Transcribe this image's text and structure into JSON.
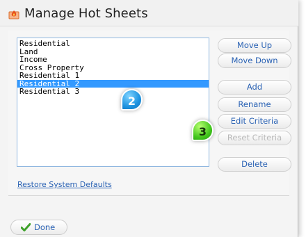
{
  "dialog": {
    "title": "Manage Hot Sheets",
    "title_icon": "flame-icon"
  },
  "hot_sheets": {
    "items": [
      "Residential",
      "Land",
      "Income",
      "Cross Property",
      "Residential 1",
      "Residential 2",
      "Residential 3"
    ],
    "selected": "Residential 2"
  },
  "buttons": {
    "move_up": "Move Up",
    "move_down": "Move Down",
    "add": "Add",
    "rename": "Rename",
    "edit_criteria": "Edit Criteria",
    "reset_criteria": "Reset Criteria",
    "delete": "Delete"
  },
  "restore_link": "Restore System Defaults",
  "done": "Done",
  "annotations": {
    "step_list": "2",
    "step_edit": "3"
  },
  "colors": {
    "selection": "#3399ff",
    "link": "#2a62b4",
    "badge_blue": "#1d93e0",
    "badge_green": "#43c71d"
  }
}
